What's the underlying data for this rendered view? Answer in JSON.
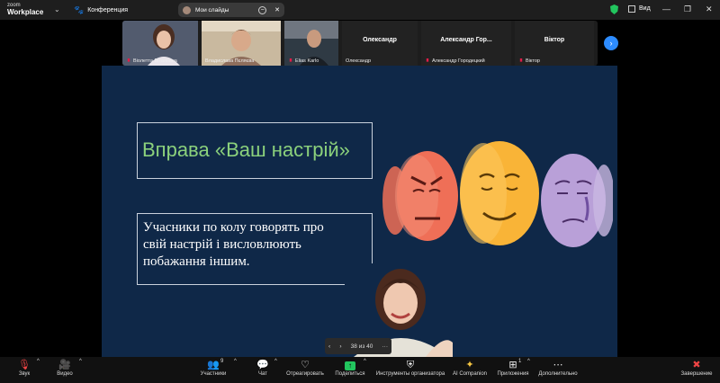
{
  "titlebar": {
    "brand_top": "zoom",
    "brand_bottom": "Workplace",
    "meeting_label": "Конференция",
    "share_pill_label": "Мои слайды",
    "view_label": "Вид"
  },
  "participants": [
    {
      "name": "Віолетта Віталіївна",
      "muted": true,
      "has_video": true
    },
    {
      "name": "Владислава Пєляєва",
      "muted": false,
      "has_video": true,
      "active": true
    },
    {
      "name": "Elias Karlo",
      "muted": true,
      "has_video": true
    },
    {
      "name": "Олександр",
      "display": "Олександр",
      "muted": false,
      "has_video": false
    },
    {
      "name": "Александр Городецкий",
      "display": "Александр Гор...",
      "muted": true,
      "has_video": false
    },
    {
      "name": "Віктор",
      "display": "Віктор",
      "muted": true,
      "has_video": false
    }
  ],
  "slide": {
    "title": "Вправа «Ваш настрій»",
    "body_lines": [
      "Учасники по колу говорять про",
      "свій настрій і висловлюють",
      "побажання іншим."
    ],
    "page_indicator": "38 из 40"
  },
  "toolbar": {
    "audio": "Звук",
    "video": "Видео",
    "participants": "Участники",
    "participants_count": "9",
    "chat": "Чат",
    "react": "Отреагировать",
    "share": "Поделиться",
    "host_tools": "Инструменты организатора",
    "ai": "AI Companion",
    "apps": "Приложения",
    "apps_count": "1",
    "more": "Дополнительно",
    "end": "Завершение"
  },
  "colors": {
    "slide_bg": "#0f2848",
    "slide_title": "#8bd17c",
    "active_speaker": "#22c55e",
    "share_green": "#22c55e",
    "end_red": "#ef4444",
    "mask_red": "#ef6f57",
    "mask_yellow": "#f9b437",
    "mask_purple": "#b9a0d8"
  }
}
